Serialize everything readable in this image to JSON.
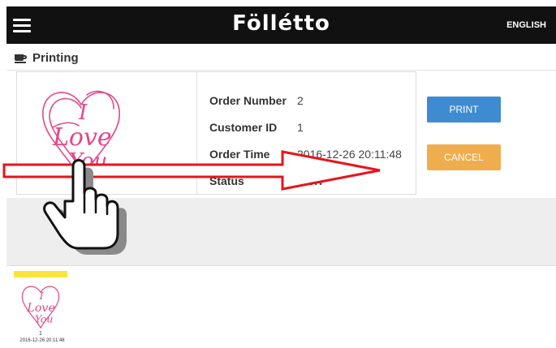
{
  "header": {
    "brand": "Föllétto",
    "language": "ENGLISH"
  },
  "panel": {
    "title": "Printing",
    "order": {
      "number_label": "Order Number",
      "number_value": "2",
      "customer_label": "Customer ID",
      "customer_value": "1",
      "time_label": "Order Time",
      "time_value": "2016-12-26 20:11:48",
      "status_label": "Status",
      "status_value": "NEW"
    },
    "print_label": "PRINT",
    "cancel_label": "CANCEL"
  },
  "thumbnails": [
    {
      "number": "1",
      "date": "2016-12-26 20:11:48"
    }
  ],
  "colors": {
    "print_button": "#3f8bd1",
    "cancel_button": "#f0ad4e",
    "thumb_bar": "#f8e43a",
    "artwork": "#e4478a",
    "arrow": "#e8141b"
  },
  "icons": {
    "menu": "hamburger-icon",
    "panel": "coffee-cup-icon",
    "pointer": "hand-pointer-icon"
  }
}
